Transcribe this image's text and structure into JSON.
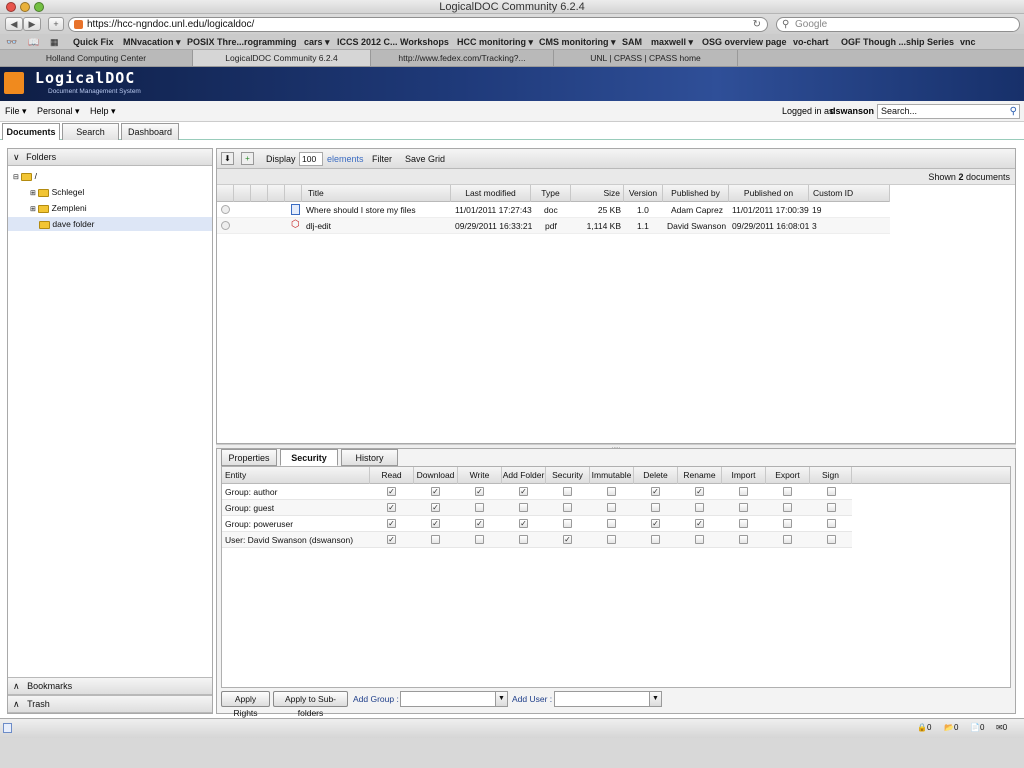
{
  "window": {
    "title": "LogicalDOC Community 6.2.4"
  },
  "browser": {
    "url": "https://hcc-ngndoc.unl.edu/logicaldoc/",
    "search_placeholder": "Google",
    "bookmarks": [
      "Quick Fix",
      "MNvacation ▾",
      "POSIX Thre...rogramming",
      "cars ▾",
      "ICCS 2012 C... Workshops",
      "HCC monitoring ▾",
      "CMS monitoring ▾",
      "SAM",
      "maxwell ▾",
      "OSG overview page",
      "vo-chart",
      "OGF Though ...ship Series",
      "vnc"
    ],
    "tabs": [
      "Holland Computing Center",
      "LogicalDOC Community 6.2.4",
      "http://www.fedex.com/Tracking?...",
      "UNL | CPASS | CPASS home"
    ]
  },
  "app": {
    "logo_text": "LogicalDOC",
    "logo_subtitle": "Document Management System",
    "menus": [
      "File ▾",
      "Personal ▾",
      "Help ▾"
    ],
    "logged_in_prefix": "Logged in as",
    "username": "dswanson",
    "search_placeholder": "Search...",
    "main_tabs": [
      "Documents",
      "Search",
      "Dashboard"
    ]
  },
  "folders": {
    "header": "Folders",
    "root": "/",
    "items": [
      "Schlegel",
      "Zempleni",
      "dave folder"
    ],
    "bookmarks": "Bookmarks",
    "trash": "Trash"
  },
  "doc_toolbar": {
    "display_label": "Display",
    "display_count": "100",
    "elements_label": "elements",
    "filter_label": "Filter",
    "save_grid_label": "Save Grid",
    "shown_prefix": "Shown",
    "shown_count": "2",
    "shown_suffix": "documents"
  },
  "documents": {
    "columns": [
      "Title",
      "Last modified",
      "Type",
      "Size",
      "Version",
      "Published by",
      "Published on",
      "Custom ID"
    ],
    "rows": [
      {
        "icon": "word-doc-icon",
        "title": "Where should I store my files",
        "modified": "11/01/2011 17:27:43",
        "type": "doc",
        "size": "25 KB",
        "version": "1.0",
        "published_by": "Adam Caprez",
        "published_on": "11/01/2011 17:00:39",
        "custom_id": "19"
      },
      {
        "icon": "pdf-icon",
        "title": "dlj-edit",
        "modified": "09/29/2011 16:33:21",
        "type": "pdf",
        "size": "1,114 KB",
        "version": "1.1",
        "published_by": "David Swanson",
        "published_on": "09/29/2011 16:08:01",
        "custom_id": "3"
      }
    ]
  },
  "detail_tabs": [
    "Properties",
    "Security",
    "History"
  ],
  "security": {
    "columns": [
      "Entity",
      "Read",
      "Download",
      "Write",
      "Add Folder",
      "Security",
      "Immutable",
      "Delete",
      "Rename",
      "Import",
      "Export",
      "Sign"
    ],
    "rows": [
      {
        "entity": "Group: author",
        "perms": [
          true,
          true,
          true,
          true,
          false,
          false,
          true,
          true,
          false,
          false,
          false
        ]
      },
      {
        "entity": "Group: guest",
        "perms": [
          true,
          true,
          false,
          false,
          false,
          false,
          false,
          false,
          false,
          false,
          false
        ]
      },
      {
        "entity": "Group: poweruser",
        "perms": [
          true,
          true,
          true,
          true,
          false,
          false,
          true,
          true,
          false,
          false,
          false
        ]
      },
      {
        "entity": "User: David Swanson (dswanson)",
        "perms": [
          true,
          false,
          false,
          false,
          true,
          false,
          false,
          false,
          false,
          false,
          false
        ]
      }
    ],
    "apply_rights": "Apply Rights",
    "apply_subfolders": "Apply to Sub-folders",
    "add_group": "Add Group :",
    "add_user": "Add User :"
  },
  "status": {
    "counters": [
      "0",
      "0",
      "0",
      "0"
    ]
  }
}
